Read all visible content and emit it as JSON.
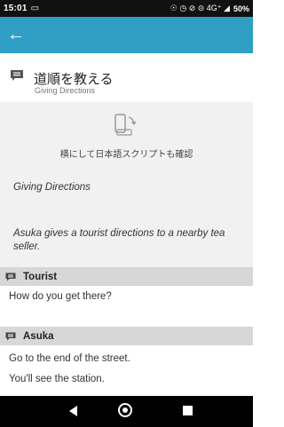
{
  "status_bar": {
    "time": "15:01",
    "icons": "☉ ◷ ⊘ ⊝ 4G⁺ ◢",
    "battery": "50%"
  },
  "app_bar": {
    "back_icon": "←",
    "color": "#2f9fc6"
  },
  "lesson": {
    "title": "道順を教える",
    "subtitle": "Giving Directions"
  },
  "intro": {
    "rotate_hint": "横にして日本語スクリプトも確認",
    "title": "Giving Directions",
    "description": "Asuka gives a tourist directions to a nearby tea seller."
  },
  "dialogue": [
    {
      "speaker": "Tourist",
      "lines": [
        "How do you get there?"
      ]
    },
    {
      "speaker": "Asuka",
      "lines": [
        "Go to the end of the street.",
        "You'll see the station."
      ]
    }
  ],
  "colors": {
    "accent": "#2f9fc6",
    "speaker_bg": "#d7d7d7",
    "content_bg": "#f1f1f1"
  }
}
